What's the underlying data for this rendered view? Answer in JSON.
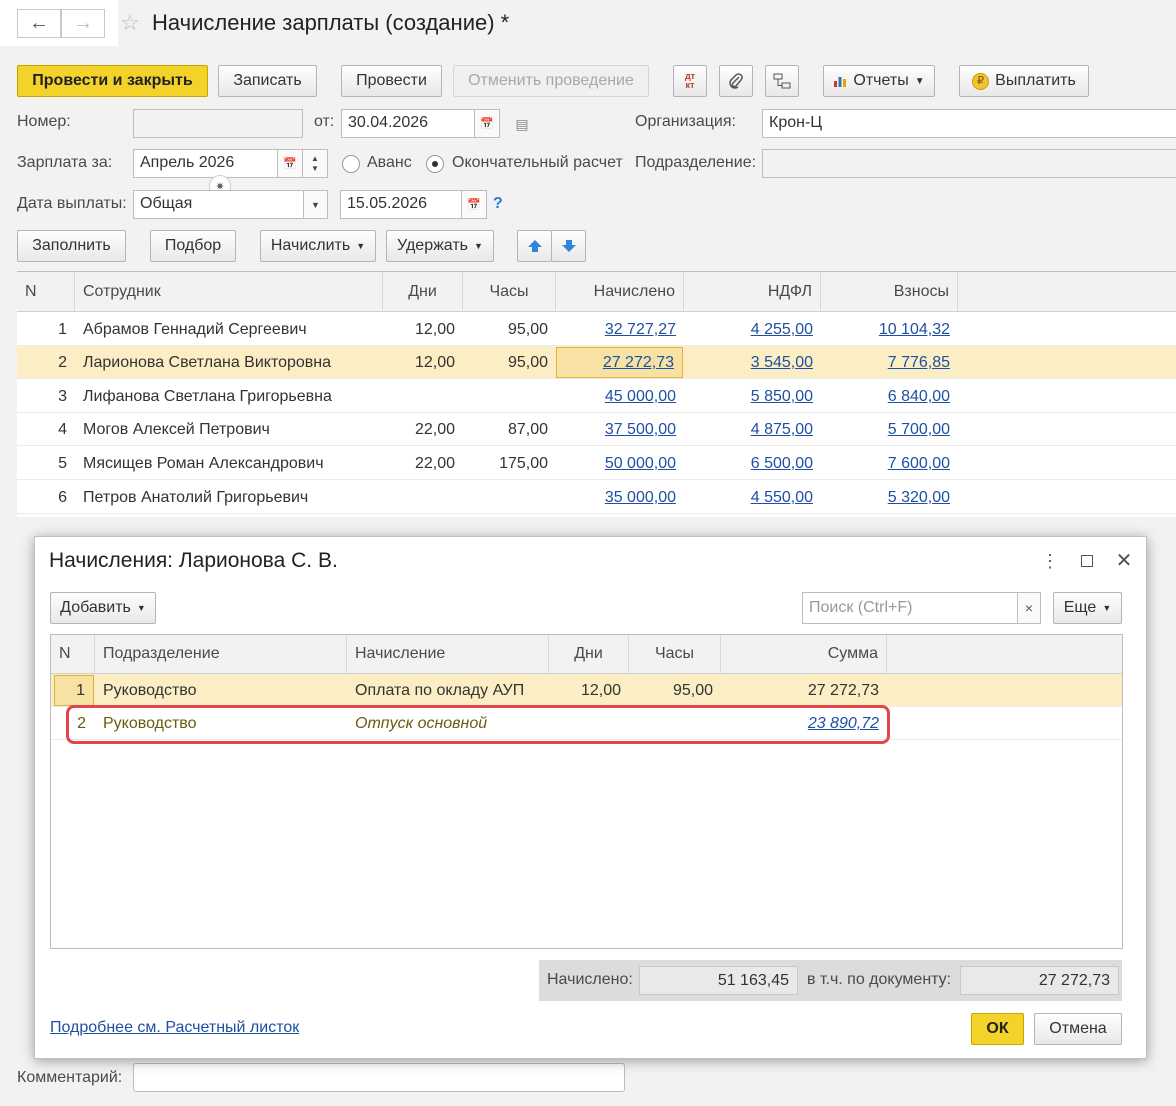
{
  "window": {
    "title": "Начисление зарплаты (создание) *"
  },
  "toolbar": {
    "post_close": "Провести и закрыть",
    "save": "Записать",
    "post": "Провести",
    "unpost": "Отменить проведение",
    "reports": "Отчеты",
    "pay": "Выплатить"
  },
  "header": {
    "number_label": "Номер:",
    "number_value": "",
    "from_label": "от:",
    "date_value": "30.04.2026",
    "org_label": "Организация:",
    "org_value": "Крон-Ц",
    "salary_for_label": "Зарплата за:",
    "salary_for_value": "Апрель 2026",
    "advance_label": "Аванс",
    "final_label": "Окончательный расчет",
    "division_label": "Подразделение:",
    "division_value": "",
    "pay_date_label": "Дата выплаты:",
    "pay_type_value": "Общая",
    "pay_date_value": "15.05.2026",
    "help": "?"
  },
  "actions": {
    "fill": "Заполнить",
    "pick": "Подбор",
    "accrue": "Начислить",
    "withhold": "Удержать"
  },
  "table": {
    "headers": [
      "N",
      "Сотрудник",
      "Дни",
      "Часы",
      "Начислено",
      "НДФЛ",
      "Взносы"
    ],
    "rows": [
      {
        "n": "1",
        "employee": "Абрамов Геннадий Сергеевич",
        "days": "12,00",
        "hours": "95,00",
        "accrued": "32 727,27",
        "ndfl": "4 255,00",
        "contrib": "10 104,32"
      },
      {
        "n": "2",
        "employee": "Ларионова Светлана Викторовна",
        "days": "12,00",
        "hours": "95,00",
        "accrued": "27 272,73",
        "ndfl": "3 545,00",
        "contrib": "7 776,85"
      },
      {
        "n": "3",
        "employee": "Лифанова Светлана Григорьевна",
        "days": "",
        "hours": "",
        "accrued": "45 000,00",
        "ndfl": "5 850,00",
        "contrib": "6 840,00"
      },
      {
        "n": "4",
        "employee": "Могов Алексей Петрович",
        "days": "22,00",
        "hours": "87,00",
        "accrued": "37 500,00",
        "ndfl": "4 875,00",
        "contrib": "5 700,00"
      },
      {
        "n": "5",
        "employee": "Мясищев Роман Александрович",
        "days": "22,00",
        "hours": "175,00",
        "accrued": "50 000,00",
        "ndfl": "6 500,00",
        "contrib": "7 600,00"
      },
      {
        "n": "6",
        "employee": "Петров Анатолий Григорьевич",
        "days": "",
        "hours": "",
        "accrued": "35 000,00",
        "ndfl": "4 550,00",
        "contrib": "5 320,00"
      }
    ]
  },
  "comment": {
    "label": "Комментарий:",
    "value": ""
  },
  "dialog": {
    "title": "Начисления: Ларионова С. В.",
    "add": "Добавить",
    "search_placeholder": "Поиск (Ctrl+F)",
    "clear": "×",
    "more": "Еще",
    "headers": [
      "N",
      "Подразделение",
      "Начисление",
      "Дни",
      "Часы",
      "Сумма"
    ],
    "rows": [
      {
        "n": "1",
        "division": "Руководство",
        "accrual": "Оплата по окладу АУП",
        "days": "12,00",
        "hours": "95,00",
        "sum": "27 272,73"
      },
      {
        "n": "2",
        "division": "Руководство",
        "accrual": "Отпуск основной",
        "days": "",
        "hours": "",
        "sum": "23 890,72"
      }
    ],
    "total_label": "Начислено:",
    "total_value": "51 163,45",
    "doc_label": "в т.ч. по документу:",
    "doc_value": "27 272,73",
    "details_link": "Подробнее см. Расчетный листок",
    "ok": "ОК",
    "cancel": "Отмена"
  }
}
